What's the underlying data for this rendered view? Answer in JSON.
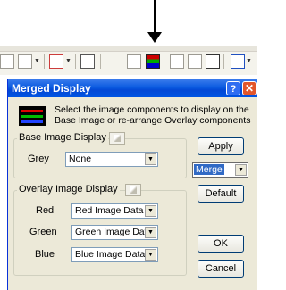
{
  "window": {
    "title": "Merged Display"
  },
  "description": "Select the image components to display on the Base Image or re-arrange Overlay components",
  "base_image": {
    "group_label": "Base Image Display",
    "grey_label": "Grey",
    "grey_value": "None"
  },
  "overlay": {
    "group_label": "Overlay Image Display",
    "red_label": "Red",
    "red_value": "Red Image Data",
    "green_label": "Green",
    "green_value": "Green Image Data",
    "blue_label": "Blue",
    "blue_value": "Blue Image Data"
  },
  "mode_select": {
    "value": "Merge"
  },
  "buttons": {
    "apply": "Apply",
    "default": "Default",
    "ok": "OK",
    "cancel": "Cancel"
  },
  "icons": [
    "dropdown-arrow-icon",
    "help-icon",
    "close-icon",
    "merged-display-icon",
    "toolbar-arrow-indicator"
  ],
  "colors": {
    "titlebar": "#0054e3",
    "dialog_bg": "#ece9d8",
    "selection": "#316ac5"
  }
}
